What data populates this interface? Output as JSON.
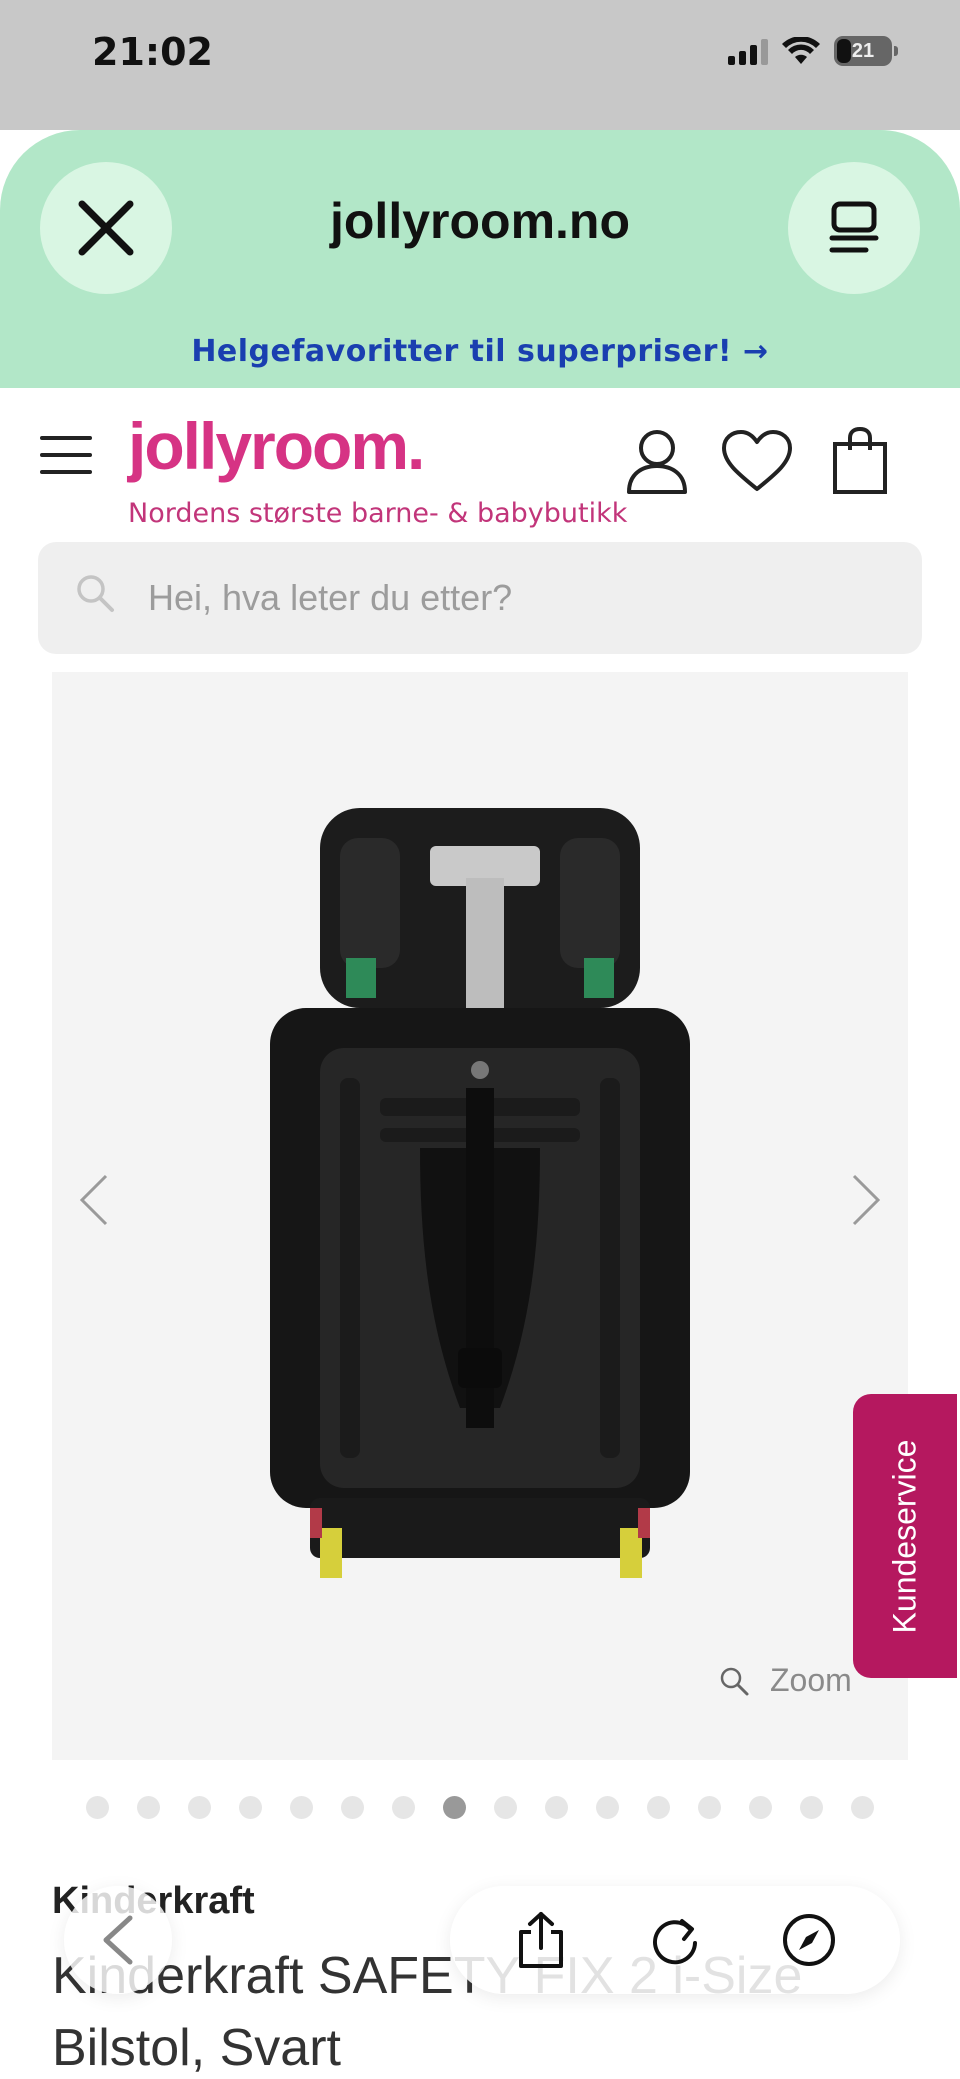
{
  "status_bar": {
    "time": "21:02",
    "battery_level": "21",
    "icons": [
      "signal-icon",
      "wifi-icon",
      "battery-icon"
    ]
  },
  "browser": {
    "url": "jollyroom.no",
    "promo_banner": "Helgefavoritter til superpriser! →",
    "icons": [
      "close-icon",
      "tabs-icon"
    ],
    "header_color": "#b2e7c8"
  },
  "site_header": {
    "logo": "jollyroom.",
    "tagline": "Nordens største barne- & babybutikk",
    "brand_color": "#d63384",
    "icons": [
      "menu-icon",
      "account-icon",
      "wishlist-heart-icon",
      "shopping-bag-icon"
    ]
  },
  "search": {
    "placeholder": "Hei, hva leter du etter?"
  },
  "gallery": {
    "zoom_label": "Zoom",
    "image_count": 16,
    "active_index": 8,
    "image_description": "car-seat-back-view"
  },
  "kundeservice": {
    "label": "Kundeservice",
    "color": "#b5185f"
  },
  "product": {
    "brand": "Kinderkraft",
    "title": "Kinderkraft SAFETY FIX 2 i-Size Bilstol, Svart"
  },
  "toolbar": {
    "icons": [
      "back-icon",
      "share-icon",
      "reload-icon",
      "compass-icon"
    ]
  }
}
